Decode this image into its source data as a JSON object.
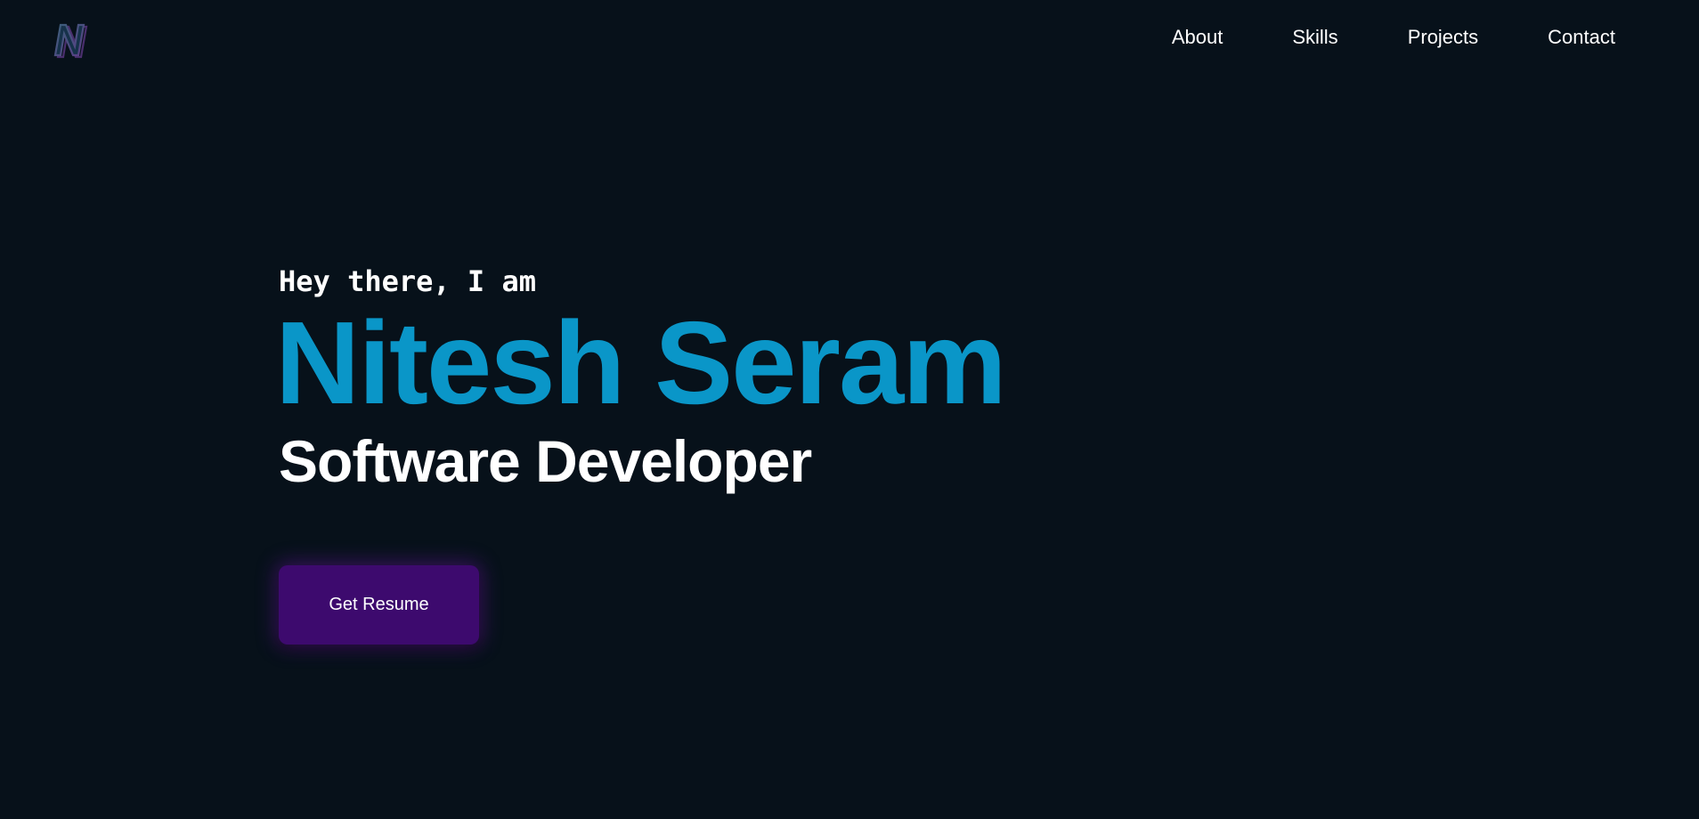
{
  "header": {
    "logo_icon": "stylized-letter-n-logo",
    "nav": [
      {
        "label": "About"
      },
      {
        "label": "Skills"
      },
      {
        "label": "Projects"
      },
      {
        "label": "Contact"
      }
    ]
  },
  "hero": {
    "greeting": "Hey there, I am",
    "name": "Nitesh Seram",
    "role": "Software Developer",
    "cta_label": "Get Resume"
  },
  "colors": {
    "background": "#07111a",
    "name_accent": "#0a96c8",
    "button_bg": "#3d0a6e",
    "text": "#ffffff"
  }
}
